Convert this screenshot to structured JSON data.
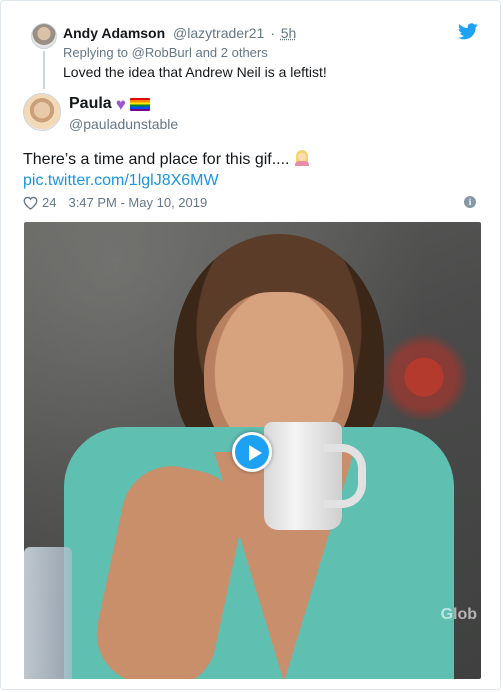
{
  "parent_tweet": {
    "display_name": "Andy Adamson",
    "handle": "@lazytrader21",
    "separator": "·",
    "time": "5h",
    "replying_prefix": "Replying to",
    "replying_to": "@RobBurl",
    "replying_suffix": "and 2 others",
    "text": "Loved the idea that Andrew Neil is a leftist!"
  },
  "main_tweet": {
    "display_name": "Paula",
    "handle": "@pauladunstable",
    "text": "There’s a time and place for this gif....",
    "link": "pic.twitter.com/1lglJ8X6MW",
    "like_count": "24",
    "timestamp": "3:47 PM - May 10, 2019"
  },
  "media": {
    "watermark": "Glob",
    "type": "gif"
  },
  "icons": {
    "logo": "twitter-bird-icon",
    "like": "heart-outline-icon",
    "info": "info-icon",
    "play": "play-icon"
  },
  "colors": {
    "link": "#1b95e0",
    "secondary_text": "#657786",
    "accent": "#1da1f2"
  }
}
